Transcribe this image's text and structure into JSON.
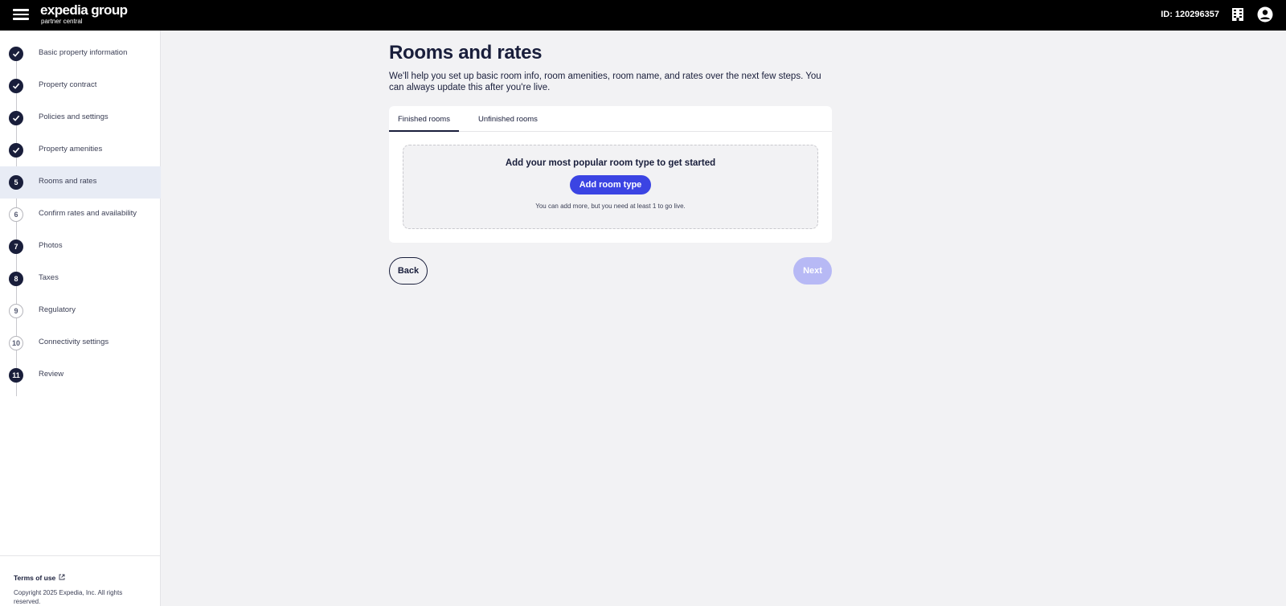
{
  "header": {
    "logo_main": "expedia group",
    "logo_sub": "partner central",
    "property_id": "ID: 120296357",
    "menu_icon": "hamburger-menu-icon",
    "building_icon": "building-icon",
    "account_icon": "account-circle-icon"
  },
  "sidebar": {
    "steps": [
      {
        "num": "",
        "label": "Basic property information",
        "state": "complete"
      },
      {
        "num": "",
        "label": "Property contract",
        "state": "complete"
      },
      {
        "num": "",
        "label": "Policies and settings",
        "state": "complete"
      },
      {
        "num": "",
        "label": "Property amenities",
        "state": "complete"
      },
      {
        "num": "5",
        "label": "Rooms and rates",
        "state": "current"
      },
      {
        "num": "6",
        "label": "Confirm rates and availability",
        "state": "outline"
      },
      {
        "num": "7",
        "label": "Photos",
        "state": "filled"
      },
      {
        "num": "8",
        "label": "Taxes",
        "state": "filled"
      },
      {
        "num": "9",
        "label": "Regulatory",
        "state": "outline"
      },
      {
        "num": "10",
        "label": "Connectivity settings",
        "state": "outline"
      },
      {
        "num": "11",
        "label": "Review",
        "state": "filled"
      }
    ],
    "footer": {
      "terms_label": "Terms of use",
      "copyright": "Copyright 2025 Expedia, Inc. All rights reserved."
    }
  },
  "main": {
    "title": "Rooms and rates",
    "intro": "We'll help you set up basic room info, room amenities, room name, and rates over the next few steps. You can always update this after you're live.",
    "tabs": [
      {
        "label": "Finished rooms",
        "active": true
      },
      {
        "label": "Unfinished rooms",
        "active": false
      }
    ],
    "empty_state": {
      "title": "Add your most popular room type to get started",
      "button_label": "Add room type",
      "note": "You can add more, but you need at least 1 to go live."
    },
    "back_label": "Back",
    "next_label": "Next"
  },
  "colors": {
    "topbar": "#000000",
    "primary_button": "#3b44e3",
    "disabled_button": "#b7b9f5",
    "navy_text": "#191e3b",
    "page_background": "#f2f2f4"
  }
}
